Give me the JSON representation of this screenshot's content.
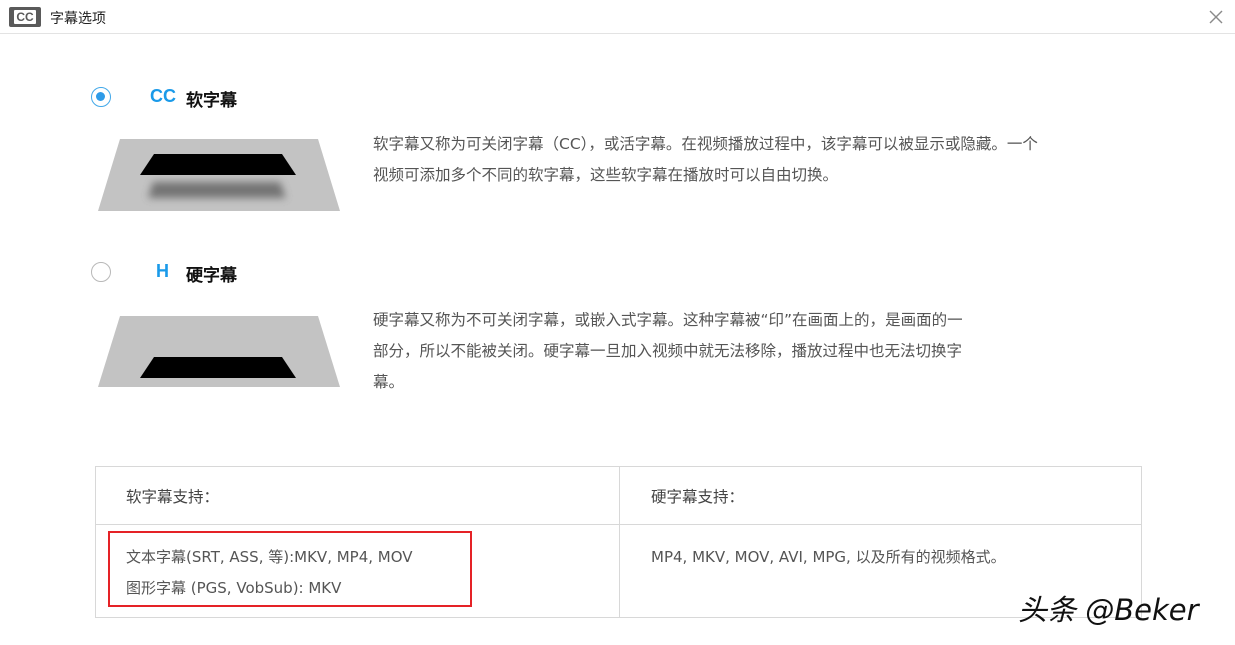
{
  "window": {
    "icon_text": "CC",
    "title": "字幕选项"
  },
  "options": [
    {
      "icon_text": "CC",
      "label": "软字幕",
      "selected": true,
      "description_lines": [
        "软字幕又称为可关闭字幕（CC），或活字幕。在视频播放过程中，该字幕可以被显示或隐藏。一个",
        "视频可添加多个不同的软字幕，这些软字幕在播放时可以自由切换。"
      ]
    },
    {
      "icon_text": "H",
      "label": "硬字幕",
      "selected": false,
      "description_lines": [
        "硬字幕又称为不可关闭字幕，或嵌入式字幕。这种字幕被“印”在画面上的，是画面的一",
        "部分，所以不能被关闭。硬字幕一旦加入视频中就无法移除，播放过程中也无法切换字",
        "幕。"
      ]
    }
  ],
  "support_table": {
    "soft_header": "软字幕支持：",
    "hard_header": "硬字幕支持：",
    "soft_lines": [
      "文本字幕(SRT, ASS, 等):MKV, MP4, MOV",
      "图形字幕 (PGS, VobSub): MKV"
    ],
    "hard_text": "MP4, MKV, MOV, AVI, MPG, 以及所有的视频格式。"
  },
  "watermark": "头条 @Beker",
  "colors": {
    "accent": "#2e9be8",
    "highlight_border": "#e52226",
    "illustration_gray": "#c3c3c3",
    "subtitle_bar": "#000000"
  }
}
